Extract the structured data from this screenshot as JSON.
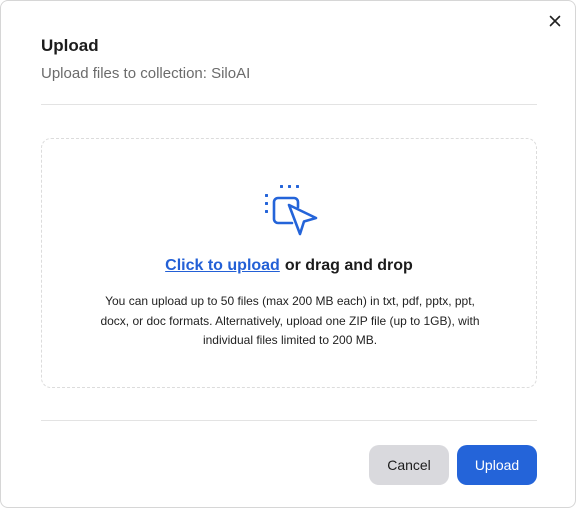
{
  "dialog": {
    "title": "Upload",
    "subtitle": "Upload files to collection: SiloAI",
    "close_icon": "close-icon"
  },
  "dropzone": {
    "icon": "pointer-select-icon",
    "link_text": "Click to upload",
    "rest_text": "or drag and drop",
    "hint": "You can upload up to 50 files (max 200 MB each) in txt, pdf, pptx, ppt, docx, or doc formats. Alternatively, upload one ZIP file (up to 1GB), with individual files limited to 200 MB."
  },
  "footer": {
    "cancel_label": "Cancel",
    "upload_label": "Upload"
  },
  "colors": {
    "accent": "#2464d9",
    "link": "#2360d6",
    "cancel_bg": "#d9d9dd"
  }
}
